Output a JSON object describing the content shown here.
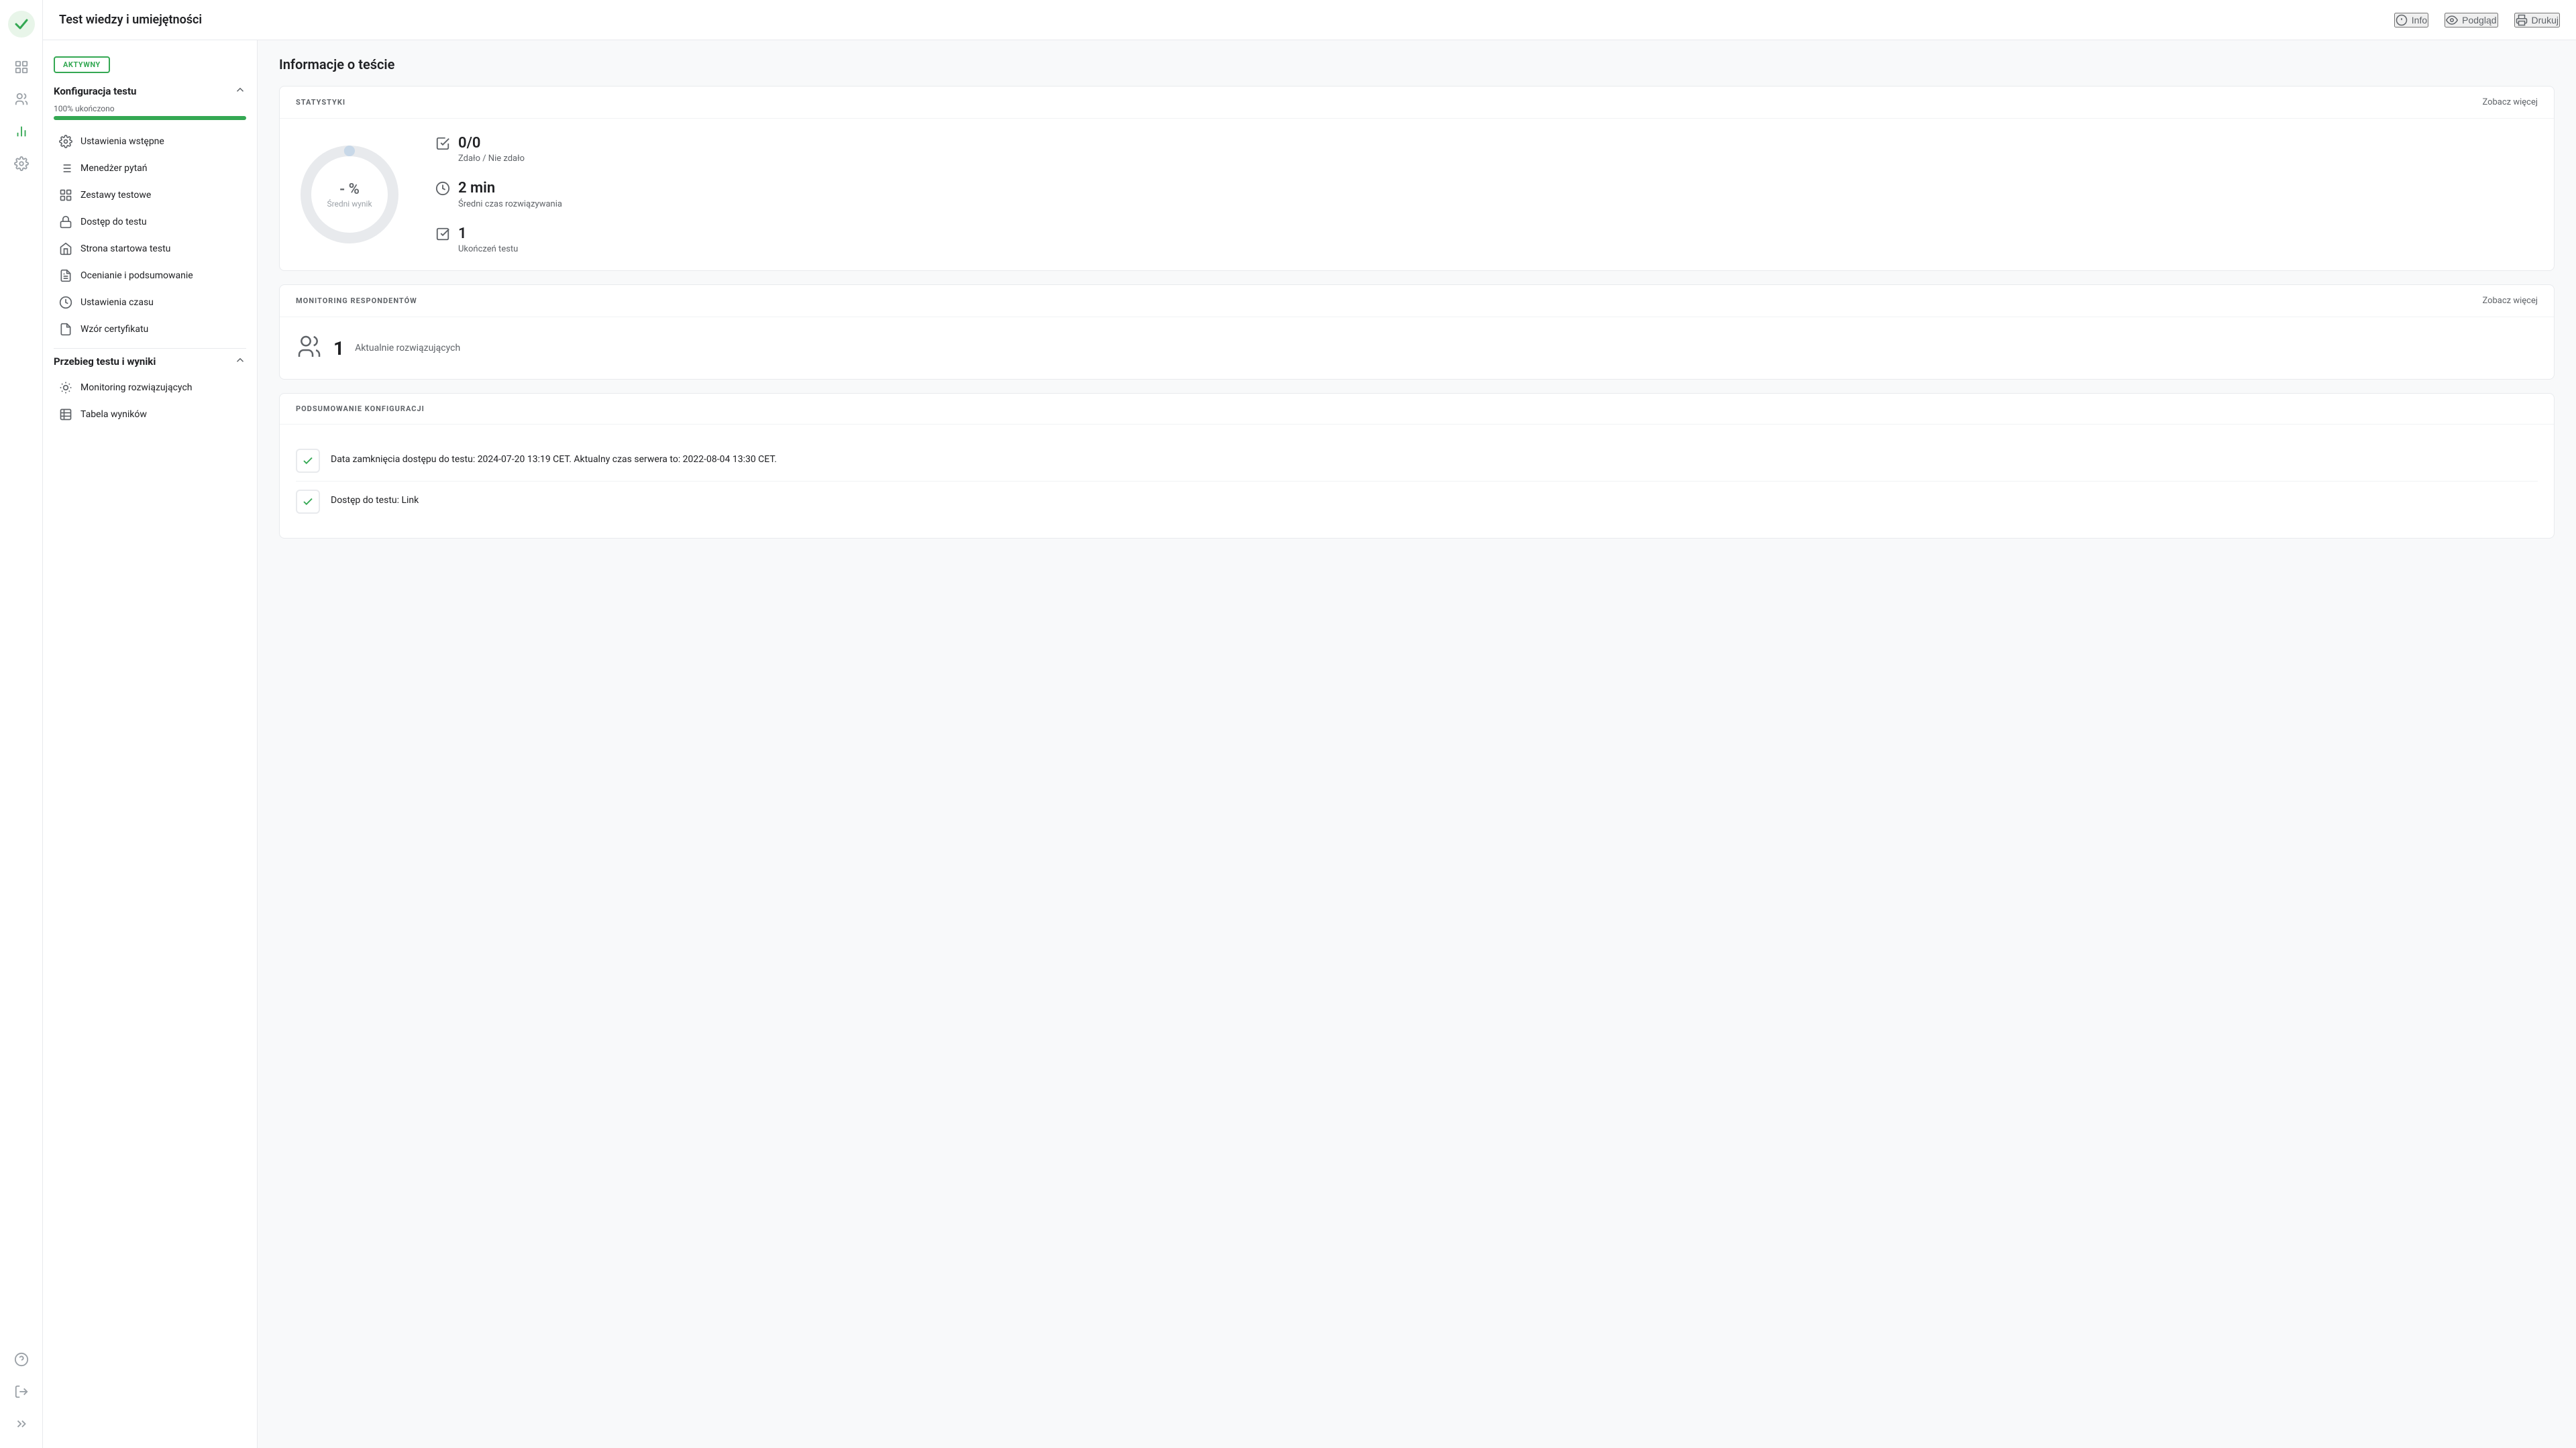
{
  "header": {
    "title": "Test wiedzy i umiejętności",
    "actions": {
      "info": "Info",
      "preview": "Podgląd",
      "print": "Drukuj"
    }
  },
  "status_badge": "AKTYWNY",
  "sidebar": {
    "config_section": {
      "title": "Konfiguracja testu",
      "progress_label": "100% ukończono",
      "progress_value": 100,
      "items": [
        {
          "label": "Ustawienia wstępne",
          "icon": "settings-icon"
        },
        {
          "label": "Menedżer pytań",
          "icon": "questions-icon"
        },
        {
          "label": "Zestawy testowe",
          "icon": "sets-icon"
        },
        {
          "label": "Dostęp do testu",
          "icon": "access-icon"
        },
        {
          "label": "Strona startowa testu",
          "icon": "start-page-icon"
        },
        {
          "label": "Ocenianie i podsumowanie",
          "icon": "grading-icon"
        },
        {
          "label": "Ustawienia czasu",
          "icon": "time-icon"
        },
        {
          "label": "Wzór certyfikatu",
          "icon": "certificate-icon"
        }
      ]
    },
    "results_section": {
      "title": "Przebieg testu i wyniki",
      "items": [
        {
          "label": "Monitoring rozwiązujących",
          "icon": "monitoring-icon"
        },
        {
          "label": "Tabela wyników",
          "icon": "results-table-icon"
        }
      ]
    }
  },
  "main": {
    "page_title": "Informacje o teście",
    "statistics": {
      "section_title": "STATYSTYKI",
      "see_more": "Zobacz więcej",
      "donut_percent": "- %",
      "donut_label": "Średni wynik",
      "metrics": [
        {
          "value": "0/0",
          "sub": "Zdało / Nie zdało",
          "icon": "check-square-icon"
        },
        {
          "value": "2 min",
          "sub": "Średni czas rozwiązywania",
          "icon": "clock-icon"
        },
        {
          "value": "1",
          "sub": "Ukończeń testu",
          "icon": "checkbox-icon"
        }
      ]
    },
    "monitoring": {
      "section_title": "MONITORING RESPONDENTÓW",
      "see_more": "Zobacz więcej",
      "count": "1",
      "label": "Aktualnie rozwiązujących"
    },
    "config_summary": {
      "section_title": "PODSUMOWANIE KONFIGURACJI",
      "items": [
        {
          "text": "Data zamknięcia dostępu do testu: 2024-07-20 13:19 CET. Aktualny czas serwera to: 2022-08-04 13:30 CET."
        },
        {
          "text": "Dostęp do testu: Link"
        }
      ]
    }
  }
}
